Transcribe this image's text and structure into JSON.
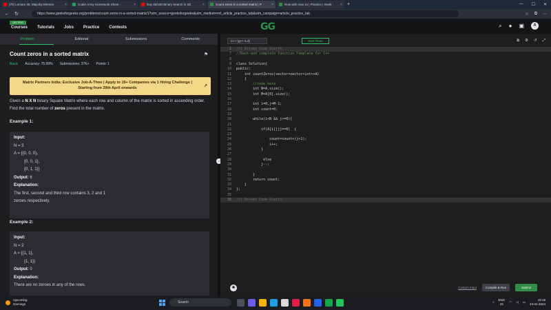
{
  "browser": {
    "tabs": [
      {
        "title": "(70) Lecture 35: Majority Elemen",
        "color": "#ff0000",
        "active": false
      },
      {
        "title": "Coder Army Homework Sheet - ",
        "color": "#22a45d",
        "active": false
      },
      {
        "title": "Day 46/180 Binary Search in 2D",
        "color": "#ff0000",
        "active": false
      },
      {
        "title": "Count zeros in a sorted matrix | P",
        "color": "#2f8d46",
        "active": true
      },
      {
        "title": "Row with max 1s | Practice | Geek",
        "color": "#2f8d46",
        "active": false
      }
    ],
    "new_tab": "+",
    "url": "https://www.geeksforgeeks.org/problems/count-zeros-in-a-sorted-matrix/1?utm_source=geeksforgeeks&utm_medium=ml_article_practice_tab&utm_campaign=article_practice_tab"
  },
  "gfg": {
    "badge": "GfG PRO",
    "menu": [
      "Courses",
      "Tutorials",
      "Jobs",
      "Practice",
      "Contests"
    ],
    "logo": "GG",
    "avatar": "A"
  },
  "left_tabs": [
    "Problem",
    "Editorial",
    "Submissions",
    "Comments"
  ],
  "problem": {
    "title": "Count zeros in a sorted matrix",
    "difficulty": "Basic",
    "accuracy": "Accuracy: 75.99%",
    "submissions": "Submissions: 37K+",
    "points": "Points: 1",
    "banner_line1": "Matrix Partners India: Exclusive Job-A-Thon | Apply to 15+ Companies via 1 Hiring Challenge |",
    "banner_line2": "Starting from 29th April onwards",
    "desc_pre": "Given a ",
    "desc_bold1": "N X N",
    "desc_mid": " binary Square Matrix where each row and column of the matrix is sorted in ascending order. Find the total number of ",
    "desc_bold2": "zeros",
    "desc_post": " present in the matrix.",
    "example1": {
      "heading": "Example 1:",
      "input_label": "Input:",
      "lines": [
        "N = 3",
        "A = {{0, 0, 0},",
        "         {0, 0, 1},",
        "         {0, 1, 1}}"
      ],
      "output_label": "Output:",
      "output": "6",
      "explanation_label": "Explanation:",
      "explanation": [
        "The first, second and third row contains 3, 2 and 1",
        "zeroes respectively."
      ]
    },
    "example2": {
      "heading": "Example 2:",
      "input_label": "Input:",
      "lines": [
        "N = 2",
        "A = {{1, 1},",
        "         {1, 1}}"
      ],
      "output_label": "Output:",
      "output": "0",
      "explanation_label": "Explanation:",
      "explanation": [
        "There are no zeroes in any of the rows."
      ]
    }
  },
  "editor": {
    "language": "C++ (g++ 5.4)",
    "timer": "Start Timer",
    "code": [
      {
        "n": "1",
        "t": "//{ Driver Code Starts",
        "fold": true
      },
      {
        "n": "7",
        "t": "//Back-end complete function Template for C++",
        "comment": true
      },
      {
        "n": "8",
        "t": ""
      },
      {
        "n": "9",
        "t": "class Solution{"
      },
      {
        "n": "10",
        "t": "public:"
      },
      {
        "n": "11",
        "t": "    int countZeros(vector<vector<int>>A)"
      },
      {
        "n": "12",
        "t": "    {"
      },
      {
        "n": "13",
        "t": "        //code here",
        "comment": true
      },
      {
        "n": "14",
        "t": "        int N=A.size();"
      },
      {
        "n": "15",
        "t": "        int M=A[0].size();"
      },
      {
        "n": "16",
        "t": ""
      },
      {
        "n": "17",
        "t": "        int i=0,j=M-1;"
      },
      {
        "n": "18",
        "t": "        int count=0;"
      },
      {
        "n": "19",
        "t": ""
      },
      {
        "n": "20",
        "t": "        while(i<N && j>=0){"
      },
      {
        "n": "21",
        "t": ""
      },
      {
        "n": "22",
        "t": "            if(A[i][j]==0)  {"
      },
      {
        "n": "23",
        "t": ""
      },
      {
        "n": "24",
        "t": "                count=count+(j+1);"
      },
      {
        "n": "25",
        "t": "                i++;"
      },
      {
        "n": "26",
        "t": "            }"
      },
      {
        "n": "27",
        "t": ""
      },
      {
        "n": "28",
        "t": "             else"
      },
      {
        "n": "29",
        "t": "            j--;"
      },
      {
        "n": "30",
        "t": ""
      },
      {
        "n": "31",
        "t": "        }"
      },
      {
        "n": "32",
        "t": "        return count;"
      },
      {
        "n": "33",
        "t": "    }"
      },
      {
        "n": "34",
        "t": "};"
      },
      {
        "n": "35",
        "t": ""
      },
      {
        "n": "36",
        "t": "//{ Driver Code Starts.",
        "fold": true
      }
    ],
    "custom_input": "Custom Input",
    "compile_run": "Compile & Run",
    "submit": "Submit"
  },
  "taskbar": {
    "weather_title": "Upcoming",
    "weather_sub": "Earnings",
    "search": "Search",
    "lang": "ENG",
    "region": "IN",
    "time": "19:19",
    "date": "23-04-2024"
  },
  "colors": {
    "accent": "#2f8d46",
    "green_text": "#2fbd6a",
    "banner": "#f4d88a"
  }
}
